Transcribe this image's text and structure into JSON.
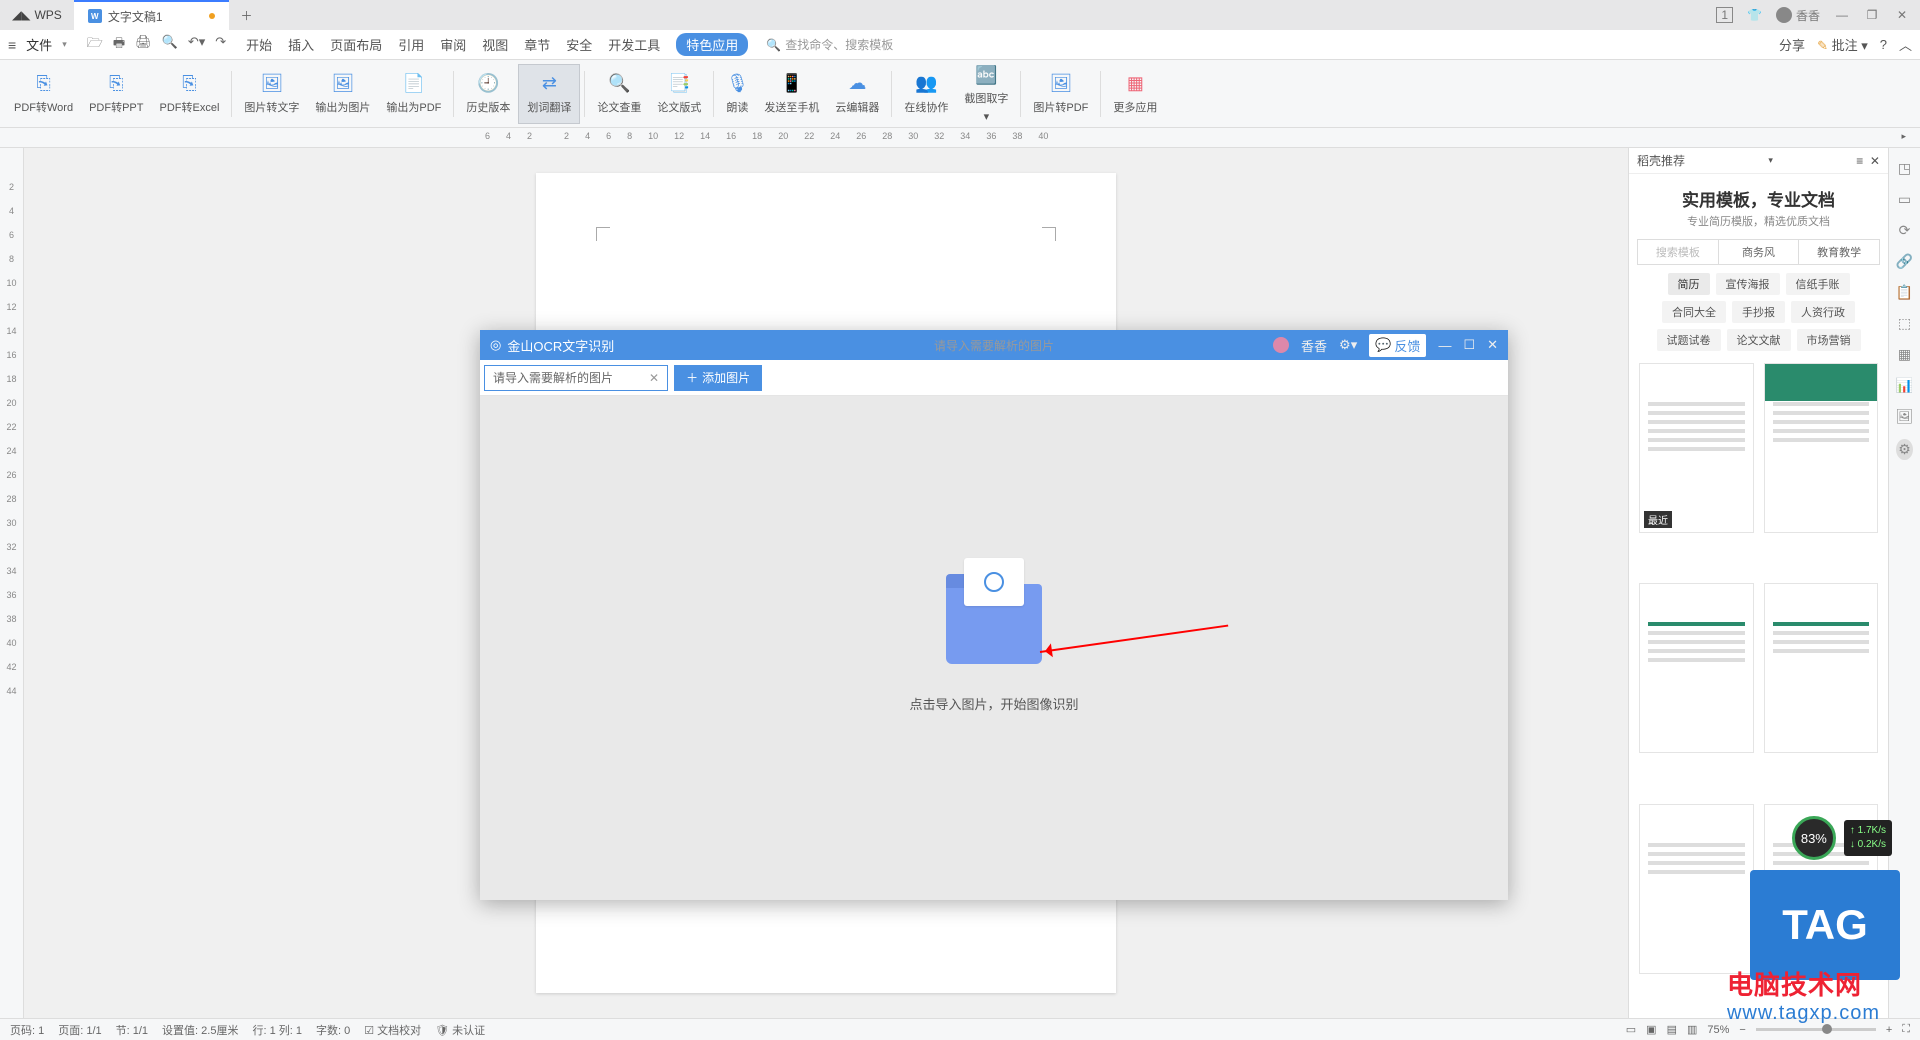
{
  "titlebar": {
    "app": "WPS",
    "doc_tab": "文字文稿1",
    "user_name": "香香",
    "notif_badge": "1"
  },
  "menubar": {
    "file": "文件",
    "tabs": [
      "开始",
      "插入",
      "页面布局",
      "引用",
      "审阅",
      "视图",
      "章节",
      "安全",
      "开发工具",
      "特色应用"
    ],
    "search_placeholder": "查找命令、搜索模板",
    "right_share": "分享",
    "right_approve": "批注"
  },
  "ribbon": {
    "items": [
      "PDF转Word",
      "PDF转PPT",
      "PDF转Excel",
      "图片转文字",
      "输出为图片",
      "输出为PDF",
      "历史版本",
      "划词翻译",
      "论文查重",
      "论文版式",
      "朗读",
      "发送至手机",
      "云编辑器",
      "在线协作",
      "截图取字",
      "图片转PDF",
      "更多应用"
    ]
  },
  "ruler_h": [
    "6",
    "4",
    "2",
    "",
    "2",
    "4",
    "6",
    "8",
    "10",
    "12",
    "14",
    "16",
    "18",
    "20",
    "22",
    "24",
    "26",
    "28",
    "30",
    "32",
    "34",
    "36",
    "38",
    "40"
  ],
  "ruler_v": [
    "",
    "2",
    "4",
    "6",
    "8",
    "10",
    "12",
    "14",
    "16",
    "18",
    "20",
    "22",
    "24",
    "26",
    "28",
    "30",
    "32",
    "34",
    "36",
    "38",
    "40",
    "42",
    "44"
  ],
  "sidebar": {
    "head": "稻壳推荐",
    "title": "实用模板，专业文档",
    "sub": "专业简历模版，精选优质文档",
    "tab_search": "搜索模板",
    "tab_biz": "商务风",
    "tab_edu": "教育教学",
    "tags": [
      "简历",
      "宣传海报",
      "信纸手账",
      "合同大全",
      "手抄报",
      "人资行政",
      "试题试卷",
      "论文文献",
      "市场营销"
    ],
    "recent_badge": "最近"
  },
  "ocr": {
    "title": "金山OCR文字识别",
    "center_hint": "请导入需要解析的图片",
    "user": "香香",
    "feedback": "反馈",
    "breadcrumb": "请导入需要解析的图片",
    "add_btn": "添加图片",
    "body_hint": "点击导入图片，开始图像识别"
  },
  "status": {
    "items": [
      "页码: 1",
      "页面: 1/1",
      "节: 1/1",
      "设置值: 2.5厘米",
      "行: 1  列: 1",
      "字数: 0",
      "文档校对",
      "未认证"
    ],
    "zoom": "75%"
  },
  "overlay": {
    "site_cn": "电脑技术网",
    "site_url": "www.tagxp.com",
    "tag": "TAG",
    "speed_pct": "83%",
    "up": "1.7K/s",
    "down": "0.2K/s"
  }
}
